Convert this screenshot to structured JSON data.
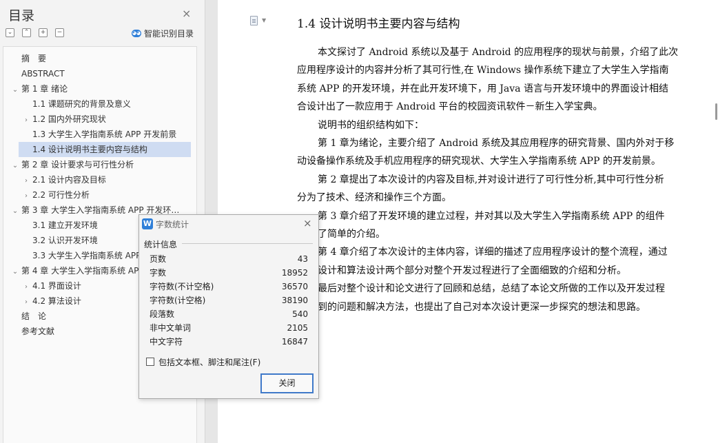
{
  "toc": {
    "title": "目录",
    "close_glyph": "×",
    "toolbar": [
      {
        "name": "collapse-all",
        "glyph": "⌄",
        "icon": "chevron-down-icon"
      },
      {
        "name": "expand-all",
        "glyph": "⌃",
        "icon": "chevron-up-icon"
      },
      {
        "name": "add-item",
        "glyph": "+",
        "icon": "plus-icon"
      },
      {
        "name": "remove-item",
        "glyph": "−",
        "icon": "minus-icon"
      }
    ],
    "smart_label": "智能识别目录",
    "smart_icon_glyph": "◕◕",
    "items": [
      {
        "label": "摘　要",
        "level": 0,
        "chevron": ""
      },
      {
        "label": "ABSTRACT",
        "level": 0,
        "chevron": ""
      },
      {
        "label": "第 1 章  绪论",
        "level": 0,
        "chevron": "expanded"
      },
      {
        "label": "1.1  课题研究的背景及意义",
        "level": 1,
        "chevron": ""
      },
      {
        "label": "1.2  国内外研究现状",
        "level": 1,
        "chevron": "collapsed"
      },
      {
        "label": "1.3  大学生入学指南系统 APP 开发前景",
        "level": 1,
        "chevron": ""
      },
      {
        "label": "1.4  设计说明书主要内容与结构",
        "level": 1,
        "chevron": "",
        "selected": true
      },
      {
        "label": "第 2 章  设计要求与可行性分析",
        "level": 0,
        "chevron": "expanded"
      },
      {
        "label": "2.1  设计内容及目标",
        "level": 1,
        "chevron": "collapsed"
      },
      {
        "label": "2.2  可行性分析",
        "level": 1,
        "chevron": "collapsed"
      },
      {
        "label": "第 3 章  大学生入学指南系统 APP 开发环…",
        "level": 0,
        "chevron": "expanded"
      },
      {
        "label": "3.1  建立开发环境",
        "level": 1,
        "chevron": ""
      },
      {
        "label": "3.2  认识开发环境",
        "level": 1,
        "chevron": ""
      },
      {
        "label": "3.3  大学生入学指南系统 APP",
        "level": 1,
        "chevron": ""
      },
      {
        "label": "第 4 章  大学生入学指南系统 AP",
        "level": 0,
        "chevron": "expanded"
      },
      {
        "label": "4.1  界面设计",
        "level": 1,
        "chevron": "collapsed"
      },
      {
        "label": "4.2  算法设计",
        "level": 1,
        "chevron": "collapsed"
      },
      {
        "label": "结　论",
        "level": 0,
        "chevron": ""
      },
      {
        "label": "参考文献",
        "level": 0,
        "chevron": ""
      }
    ]
  },
  "document": {
    "heading": "1.4  设计说明书主要内容与结构",
    "lines": [
      {
        "text": "本文探讨了 Android 系统以及基于 Android 的应用程序的现状与前景，介绍了此次",
        "indent": true
      },
      {
        "text": "应用程序设计的内容并分析了其可行性,在 Windows 操作系统下建立了大学生入学指南",
        "indent": false
      },
      {
        "text": "系统 APP 的开发环境，并在此开发环境下，用 Java 语言与开发环境中的界面设计相结",
        "indent": false
      },
      {
        "text": "合设计出了一款应用于 Android 平台的校园资讯软件－新生入学宝典。",
        "indent": false
      },
      {
        "text": "说明书的组织结构如下：",
        "indent": true
      },
      {
        "text": "第 1 章为绪论，主要介绍了 Android 系统及其应用程序的研究背景、国内外对于移",
        "indent": true
      },
      {
        "text": "动设备操作系统及手机应用程序的研究现状、大学生入学指南系统 APP 的开发前景。",
        "indent": false
      },
      {
        "text": "第 2 章提出了本次设计的内容及目标,并对设计进行了可行性分析,其中可行性分析",
        "indent": true
      },
      {
        "text": "分为了技术、经济和操作三个方面。",
        "indent": false
      },
      {
        "text": "第 3 章介绍了开发环境的建立过程，并对其以及大学生入学指南系统 APP 的组件",
        "indent": true
      },
      {
        "text": "了简单的介绍。",
        "indent": true
      },
      {
        "text": "第 4 章介绍了本次设计的主体内容，详细的描述了应用程序设计的整个流程，通过",
        "indent": true
      },
      {
        "text": "设计和算法设计两个部分对整个开发过程进行了全面细致的介绍和分析。",
        "indent": true
      },
      {
        "text": "最后对整个设计和论文进行了回顾和总结，总结了本论文所做的工作以及开发过程",
        "indent": true
      },
      {
        "text": "到的问题和解决方法，也提出了自己对本次设计更深一步探究的想法和思路。",
        "indent": true
      }
    ]
  },
  "dialog": {
    "title": "字数统计",
    "app_icon_glyph": "W",
    "close_glyph": "×",
    "section": "统计信息",
    "stats": [
      {
        "label": "页数",
        "value": "43"
      },
      {
        "label": "字数",
        "value": "18952"
      },
      {
        "label": "字符数(不计空格)",
        "value": "36570"
      },
      {
        "label": "字符数(计空格)",
        "value": "38190"
      },
      {
        "label": "段落数",
        "value": "540"
      },
      {
        "label": "非中文单词",
        "value": "2105"
      },
      {
        "label": "中文字符",
        "value": "16847"
      }
    ],
    "checkbox_label": "包括文本框、脚注和尾注(F)",
    "checkbox_checked": false,
    "close_button": "关闭"
  },
  "colors": {
    "accent": "#3f79c9",
    "selected_bg": "#cfdcf2",
    "app_icon": "#2f7fd8"
  }
}
